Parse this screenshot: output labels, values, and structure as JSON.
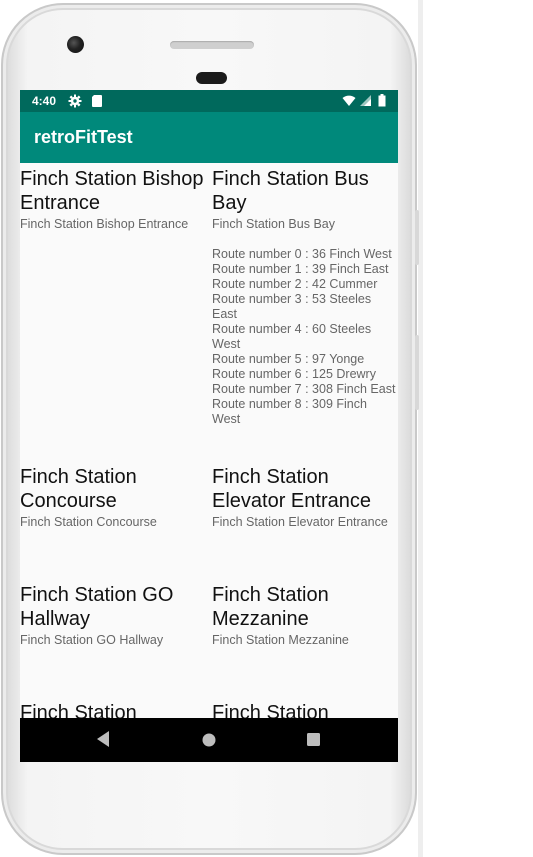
{
  "status_bar": {
    "time": "4:40",
    "left_icons": [
      "gear-icon",
      "sd-card-icon"
    ],
    "right_icons": [
      "wifi-icon",
      "signal-icon",
      "battery-icon"
    ]
  },
  "app_bar": {
    "title": "retroFitTest"
  },
  "items": [
    {
      "title": "Finch Station Bishop Entrance",
      "subtitle": "Finch Station Bishop Entrance",
      "routes": []
    },
    {
      "title": "Finch Station Bus Bay",
      "subtitle": "Finch Station Bus Bay",
      "routes": [
        "Route number 0 : 36 Finch West",
        "Route number 1 : 39 Finch East",
        "Route number 2 : 42 Cummer",
        "Route number 3 : 53 Steeles East",
        "Route number 4 : 60 Steeles West",
        "Route number 5 : 97 Yonge",
        "Route number 6 : 125 Drewry",
        "Route number 7 : 308 Finch East",
        "Route number 8 : 309 Finch West"
      ]
    },
    {
      "title": "Finch Station Concourse",
      "subtitle": "Finch Station Concourse",
      "routes": []
    },
    {
      "title": "Finch Station Elevator Entrance",
      "subtitle": "Finch Station Elevator Entrance",
      "routes": []
    },
    {
      "title": "Finch Station GO Hallway",
      "subtitle": "Finch Station GO Hallway",
      "routes": []
    },
    {
      "title": "Finch Station Mezzanine",
      "subtitle": "Finch Station Mezzanine",
      "routes": []
    },
    {
      "title": "Finch Station",
      "subtitle": "",
      "routes": []
    },
    {
      "title": "Finch Station",
      "subtitle": "",
      "routes": []
    }
  ],
  "nav_bar": {
    "buttons": [
      "back-icon",
      "home-icon",
      "recents-icon"
    ]
  },
  "colors": {
    "status_bar": "#00695c",
    "app_bar": "#00897b",
    "screen_background": "#fafafa",
    "nav_bar": "#000000"
  }
}
